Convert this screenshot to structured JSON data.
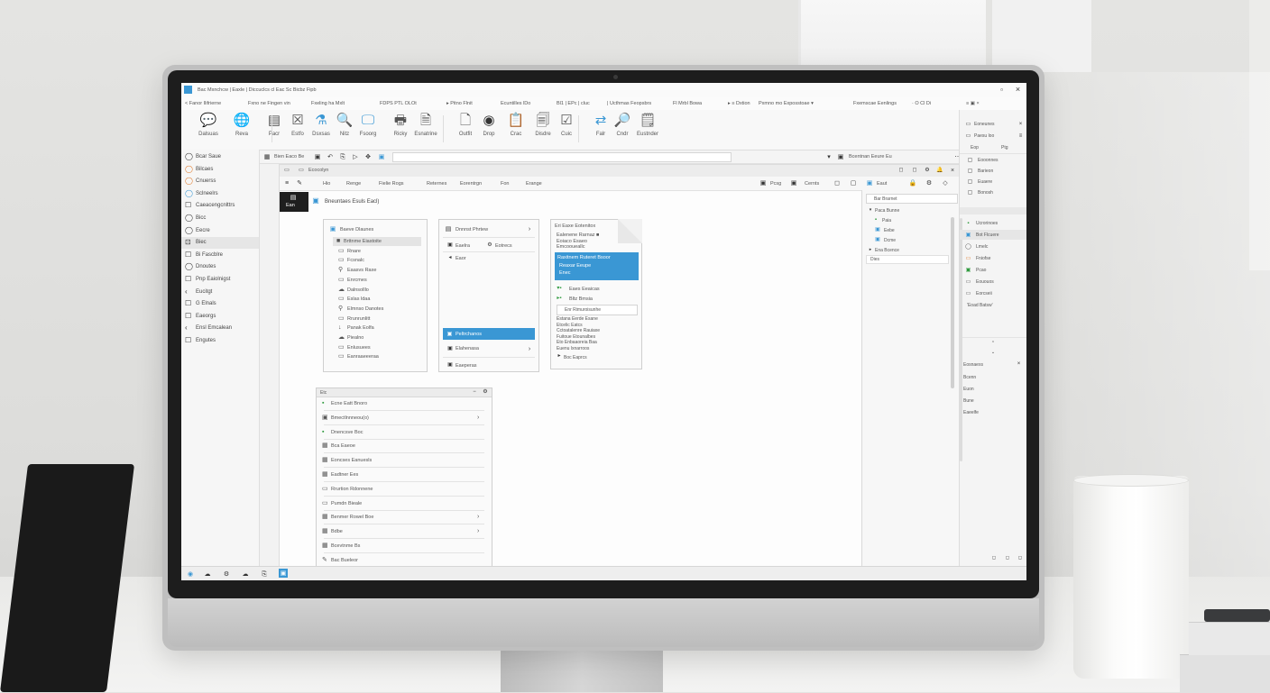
{
  "colors": {
    "accent": "#3a97d4",
    "green": "#2f9a3e",
    "orange": "#e07a2a"
  },
  "titlebar": {
    "text": "Bac Mxnchcw | Eaxle | Diccuclcs cl Eac Sc Bicbz Fipb"
  },
  "menubar": {
    "items": [
      "< Fanor Ilifrierne",
      "Fxno ne Fingen vin",
      "Fxeling ha Mxlt",
      "FDPS PTL OLOt",
      "▸ Pitno Flnit",
      "Ecuntilles lDo",
      "Bl1 | EPc | cluc",
      "| Ucthmas Feopsbrs",
      "Fl Mrbl Bowa",
      "▸ ≡ Dxtion",
      "Pxmno mo Exposstoae ▾",
      "Fxemscae Eenlings",
      "· O Cl Di",
      "≡ ▣ ×"
    ]
  },
  "ribbon": {
    "buttons": [
      {
        "icon": "chat-green-icon",
        "glyph": "💬",
        "label": "Dalsuas"
      },
      {
        "icon": "globe-icon",
        "glyph": "🌐",
        "label": "Reva"
      },
      {
        "icon": "layout-icon",
        "glyph": "▤",
        "label": "Pacr"
      },
      {
        "icon": "close-box-icon",
        "glyph": "☒",
        "label": "Estfo"
      },
      {
        "icon": "flask-icon",
        "glyph": "⚗",
        "label": "Dsxsas"
      },
      {
        "icon": "person-search-icon",
        "glyph": "🔍",
        "label": "Nitz"
      },
      {
        "icon": "monitor-icon",
        "glyph": "🖵",
        "label": "Fsoorg"
      },
      {
        "icon": "printer-icon",
        "glyph": "🖶",
        "label": "Ricky"
      },
      {
        "icon": "document-icon",
        "glyph": "🗎",
        "label": "Esnatrine"
      },
      {
        "icon": "page-cursor-icon",
        "glyph": "🗋",
        "label": "Outfit"
      },
      {
        "icon": "disc-icon",
        "glyph": "◉",
        "label": "Drop"
      },
      {
        "icon": "clipboard-icon",
        "glyph": "📋",
        "label": "Crac"
      },
      {
        "icon": "files-icon",
        "glyph": "🗐",
        "label": "Disdre"
      },
      {
        "icon": "check-icon",
        "glyph": "☑",
        "label": "Cuic"
      },
      {
        "icon": "share-icon",
        "glyph": "⇄",
        "label": "Falr"
      },
      {
        "icon": "search-doc-icon",
        "glyph": "🔎",
        "label": "Cndr"
      },
      {
        "icon": "notes-icon",
        "glyph": "🗒",
        "label": "Eustnder"
      }
    ]
  },
  "leftnav": {
    "items": [
      {
        "icon": "◯",
        "label": "Bcar Saue"
      },
      {
        "icon": "◯",
        "label": "Bilcaes"
      },
      {
        "icon": "◯",
        "label": "Cnuerss"
      },
      {
        "icon": "◯",
        "label": "Sclneelrs"
      },
      {
        "icon": "☐",
        "label": "Caeacengcnlttrs"
      },
      {
        "icon": "◯",
        "label": "Bicc"
      },
      {
        "icon": "◯",
        "label": "Eecre"
      },
      {
        "icon": "⊡",
        "label": "Biec"
      },
      {
        "icon": "☐",
        "label": "Bi Fascblre"
      },
      {
        "icon": "◯",
        "label": "Dnoutes"
      },
      {
        "icon": "☐",
        "label": "Pnp Eaiolnigst"
      },
      {
        "icon": "‹",
        "label": "Eucitgt"
      },
      {
        "icon": "☐",
        "label": "G Elnals"
      },
      {
        "icon": "☐",
        "label": "Eaeorgs"
      },
      {
        "icon": "‹",
        "label": "Ensl Emcalean"
      },
      {
        "icon": "☐",
        "label": "Engutes"
      }
    ]
  },
  "toolbar2": {
    "address": "Bien Eaco Be",
    "search_right": "Bcentnan Eeure Eu"
  },
  "doc": {
    "title": "Ecocolyn",
    "tabs": [
      "Hio",
      "Renge",
      "Fielie Rogs",
      "Reternes",
      "Eorentrgn",
      "Fon",
      "Erange"
    ],
    "tabs_right": [
      "Pcsg",
      "Cernts"
    ],
    "side_label": "Ean",
    "heading": "Bneuntaes Esuls Eacl)"
  },
  "card1": {
    "title": "Baeve Dlaunes",
    "items": [
      "Brttnme Eiastoite",
      "Rnare",
      "Fcsnalc",
      "Eaasvs Raxe",
      "Enrcmes",
      "Dalnsolllo",
      "Eslas ldaa",
      "Elmnso Danotes",
      "Rrunrunlitt",
      "Panak Eolfa",
      "Piealno",
      "Enlusuees",
      "Eanraaeeeraa"
    ]
  },
  "card2": {
    "title": "Dnnnst Phrtew",
    "sub_left": "Eaelra",
    "sub_right": "Eotrecs",
    "item1": "Eaor",
    "selected": "Peltrchanos",
    "item3": "Elahenasa",
    "footer": "Eaeperas"
  },
  "card3": {
    "title": "Eri Eaxe Eotenitox",
    "lines": [
      "Ealenene Rarnaz ■",
      "Eoiaco Esaeo",
      "Emcooueallc"
    ],
    "selected_title": "Raxitnem Ruteret Bsoor",
    "selected_lines": [
      "Reaxar Eeupe",
      "Enec"
    ],
    "tree": [
      "Eaes Eeaicas",
      "Bltz Bmsia"
    ],
    "input": "Enr Rimuroisunhe",
    "body": [
      "Estana Eerde Esane",
      "Etcelic Eatcs",
      "Cctoatalenre Rauiaxe",
      "Fuitoue Etounalbes",
      "Eto Enbaaoreia Baa",
      "Euenu lxnarroos"
    ],
    "footer": "Boc Eaprcs"
  },
  "lower_panel": {
    "header": "Etc",
    "items": [
      "Ecne Eatt Bnoro",
      "Bmectlnnneou(o)",
      "Dnencsve Boc",
      "Bca Eaeoe",
      "Eoncses Eanuesls",
      "Eadtner Ees",
      "Rrurtion Rdonnene",
      "Pumdn Bieale",
      "Benmer Rowel Boe",
      "Bdbe",
      "Bcevtnme Bs",
      "Bac Bueleor"
    ]
  },
  "right_panel": {
    "header": "Eaut",
    "search": "Bar Brarnet",
    "tree": [
      "Paca Bunne",
      "Paia",
      "Eebe",
      "Dcme",
      "Ena Bcence",
      "Dies"
    ]
  },
  "far_right": {
    "top": [
      "Eoneunes",
      "Paesu loo",
      "Eop",
      "Ptg"
    ],
    "mid": [
      "Eooonnes",
      "Barieon",
      "Euaere",
      "Bonosh"
    ],
    "list": [
      "Ucrorinoes",
      "Bot Flcuere",
      "Lmelc",
      "Fniofse",
      "Pcao",
      "Eououos",
      "Eorcseii",
      "'Eoad Batsw'"
    ],
    "bottom_header": "Eosnaexs",
    "bottom": [
      "Bcenn",
      "Euon",
      "Bune",
      "Eaeelfe"
    ]
  },
  "taskbar": {
    "icons": [
      "start-icon",
      "cloud-icon",
      "gear-icon",
      "cloud-icon",
      "files-icon",
      "app-icon"
    ]
  }
}
